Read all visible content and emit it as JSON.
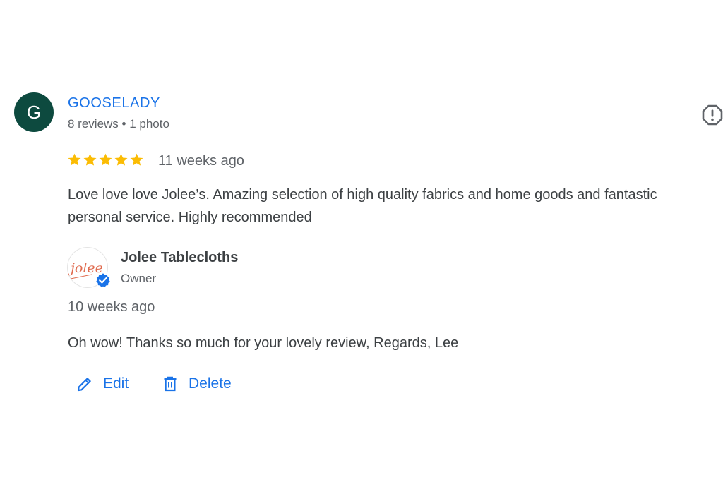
{
  "reviewer": {
    "initial": "G",
    "name": "GOOSELADY",
    "meta": "8 reviews • 1 photo"
  },
  "review": {
    "rating": 5,
    "date": "11 weeks ago",
    "text": "Love love love Jolee’s. Amazing selection of high quality fabrics and home goods and fantastic personal service. Highly recommended"
  },
  "owner_reply": {
    "owner_name": "Jolee Tablecloths",
    "owner_role": "Owner",
    "logo_text": "jolee",
    "date": "10 weeks ago",
    "text": "Oh wow! Thanks so much for your lovely review, Regards, Lee"
  },
  "actions": {
    "edit_label": "Edit",
    "delete_label": "Delete"
  },
  "colors": {
    "accent": "#1a73e8",
    "star": "#fbbc04",
    "avatar_bg": "#0d4a3f",
    "logo_text": "#e06b4f"
  },
  "icons": {
    "report": "report-icon",
    "edit": "pencil-icon",
    "delete": "trash-icon",
    "verified": "verified-badge-icon",
    "star": "star-icon"
  }
}
